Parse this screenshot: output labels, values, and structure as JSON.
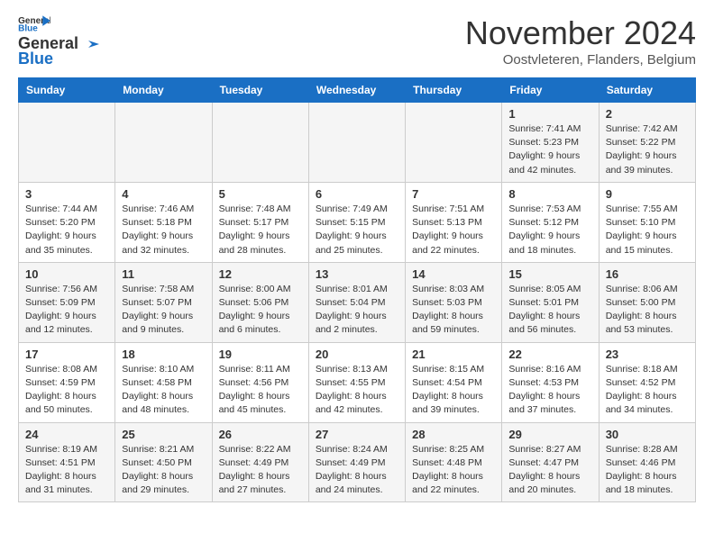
{
  "header": {
    "logo_line1": "General",
    "logo_line2": "Blue",
    "month": "November 2024",
    "location": "Oostvleteren, Flanders, Belgium"
  },
  "columns": [
    "Sunday",
    "Monday",
    "Tuesday",
    "Wednesday",
    "Thursday",
    "Friday",
    "Saturday"
  ],
  "weeks": [
    [
      {
        "day": "",
        "sunrise": "",
        "sunset": "",
        "daylight": ""
      },
      {
        "day": "",
        "sunrise": "",
        "sunset": "",
        "daylight": ""
      },
      {
        "day": "",
        "sunrise": "",
        "sunset": "",
        "daylight": ""
      },
      {
        "day": "",
        "sunrise": "",
        "sunset": "",
        "daylight": ""
      },
      {
        "day": "",
        "sunrise": "",
        "sunset": "",
        "daylight": ""
      },
      {
        "day": "1",
        "sunrise": "Sunrise: 7:41 AM",
        "sunset": "Sunset: 5:23 PM",
        "daylight": "Daylight: 9 hours and 42 minutes."
      },
      {
        "day": "2",
        "sunrise": "Sunrise: 7:42 AM",
        "sunset": "Sunset: 5:22 PM",
        "daylight": "Daylight: 9 hours and 39 minutes."
      }
    ],
    [
      {
        "day": "3",
        "sunrise": "Sunrise: 7:44 AM",
        "sunset": "Sunset: 5:20 PM",
        "daylight": "Daylight: 9 hours and 35 minutes."
      },
      {
        "day": "4",
        "sunrise": "Sunrise: 7:46 AM",
        "sunset": "Sunset: 5:18 PM",
        "daylight": "Daylight: 9 hours and 32 minutes."
      },
      {
        "day": "5",
        "sunrise": "Sunrise: 7:48 AM",
        "sunset": "Sunset: 5:17 PM",
        "daylight": "Daylight: 9 hours and 28 minutes."
      },
      {
        "day": "6",
        "sunrise": "Sunrise: 7:49 AM",
        "sunset": "Sunset: 5:15 PM",
        "daylight": "Daylight: 9 hours and 25 minutes."
      },
      {
        "day": "7",
        "sunrise": "Sunrise: 7:51 AM",
        "sunset": "Sunset: 5:13 PM",
        "daylight": "Daylight: 9 hours and 22 minutes."
      },
      {
        "day": "8",
        "sunrise": "Sunrise: 7:53 AM",
        "sunset": "Sunset: 5:12 PM",
        "daylight": "Daylight: 9 hours and 18 minutes."
      },
      {
        "day": "9",
        "sunrise": "Sunrise: 7:55 AM",
        "sunset": "Sunset: 5:10 PM",
        "daylight": "Daylight: 9 hours and 15 minutes."
      }
    ],
    [
      {
        "day": "10",
        "sunrise": "Sunrise: 7:56 AM",
        "sunset": "Sunset: 5:09 PM",
        "daylight": "Daylight: 9 hours and 12 minutes."
      },
      {
        "day": "11",
        "sunrise": "Sunrise: 7:58 AM",
        "sunset": "Sunset: 5:07 PM",
        "daylight": "Daylight: 9 hours and 9 minutes."
      },
      {
        "day": "12",
        "sunrise": "Sunrise: 8:00 AM",
        "sunset": "Sunset: 5:06 PM",
        "daylight": "Daylight: 9 hours and 6 minutes."
      },
      {
        "day": "13",
        "sunrise": "Sunrise: 8:01 AM",
        "sunset": "Sunset: 5:04 PM",
        "daylight": "Daylight: 9 hours and 2 minutes."
      },
      {
        "day": "14",
        "sunrise": "Sunrise: 8:03 AM",
        "sunset": "Sunset: 5:03 PM",
        "daylight": "Daylight: 8 hours and 59 minutes."
      },
      {
        "day": "15",
        "sunrise": "Sunrise: 8:05 AM",
        "sunset": "Sunset: 5:01 PM",
        "daylight": "Daylight: 8 hours and 56 minutes."
      },
      {
        "day": "16",
        "sunrise": "Sunrise: 8:06 AM",
        "sunset": "Sunset: 5:00 PM",
        "daylight": "Daylight: 8 hours and 53 minutes."
      }
    ],
    [
      {
        "day": "17",
        "sunrise": "Sunrise: 8:08 AM",
        "sunset": "Sunset: 4:59 PM",
        "daylight": "Daylight: 8 hours and 50 minutes."
      },
      {
        "day": "18",
        "sunrise": "Sunrise: 8:10 AM",
        "sunset": "Sunset: 4:58 PM",
        "daylight": "Daylight: 8 hours and 48 minutes."
      },
      {
        "day": "19",
        "sunrise": "Sunrise: 8:11 AM",
        "sunset": "Sunset: 4:56 PM",
        "daylight": "Daylight: 8 hours and 45 minutes."
      },
      {
        "day": "20",
        "sunrise": "Sunrise: 8:13 AM",
        "sunset": "Sunset: 4:55 PM",
        "daylight": "Daylight: 8 hours and 42 minutes."
      },
      {
        "day": "21",
        "sunrise": "Sunrise: 8:15 AM",
        "sunset": "Sunset: 4:54 PM",
        "daylight": "Daylight: 8 hours and 39 minutes."
      },
      {
        "day": "22",
        "sunrise": "Sunrise: 8:16 AM",
        "sunset": "Sunset: 4:53 PM",
        "daylight": "Daylight: 8 hours and 37 minutes."
      },
      {
        "day": "23",
        "sunrise": "Sunrise: 8:18 AM",
        "sunset": "Sunset: 4:52 PM",
        "daylight": "Daylight: 8 hours and 34 minutes."
      }
    ],
    [
      {
        "day": "24",
        "sunrise": "Sunrise: 8:19 AM",
        "sunset": "Sunset: 4:51 PM",
        "daylight": "Daylight: 8 hours and 31 minutes."
      },
      {
        "day": "25",
        "sunrise": "Sunrise: 8:21 AM",
        "sunset": "Sunset: 4:50 PM",
        "daylight": "Daylight: 8 hours and 29 minutes."
      },
      {
        "day": "26",
        "sunrise": "Sunrise: 8:22 AM",
        "sunset": "Sunset: 4:49 PM",
        "daylight": "Daylight: 8 hours and 27 minutes."
      },
      {
        "day": "27",
        "sunrise": "Sunrise: 8:24 AM",
        "sunset": "Sunset: 4:49 PM",
        "daylight": "Daylight: 8 hours and 24 minutes."
      },
      {
        "day": "28",
        "sunrise": "Sunrise: 8:25 AM",
        "sunset": "Sunset: 4:48 PM",
        "daylight": "Daylight: 8 hours and 22 minutes."
      },
      {
        "day": "29",
        "sunrise": "Sunrise: 8:27 AM",
        "sunset": "Sunset: 4:47 PM",
        "daylight": "Daylight: 8 hours and 20 minutes."
      },
      {
        "day": "30",
        "sunrise": "Sunrise: 8:28 AM",
        "sunset": "Sunset: 4:46 PM",
        "daylight": "Daylight: 8 hours and 18 minutes."
      }
    ]
  ]
}
